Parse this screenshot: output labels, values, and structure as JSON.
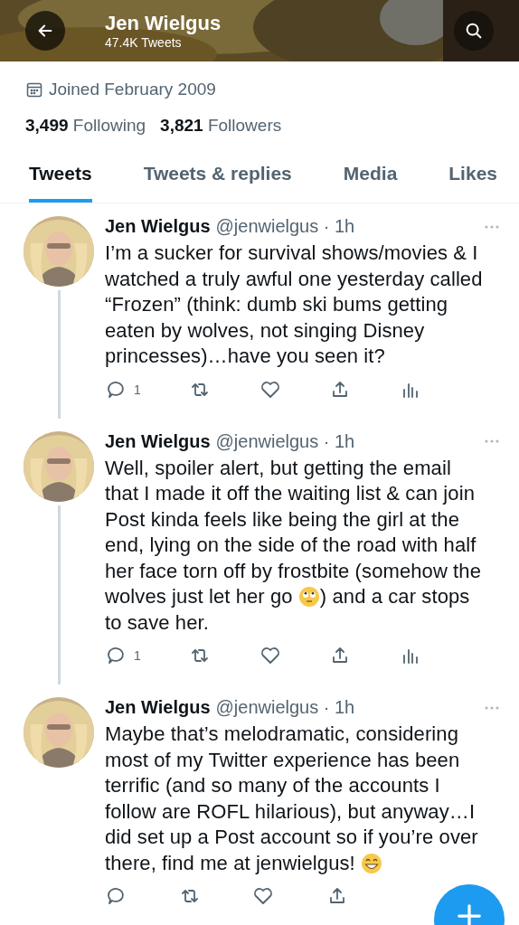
{
  "header": {
    "title": "Jen Wielgus",
    "subtitle": "47.4K Tweets"
  },
  "profile": {
    "joined": "Joined February 2009",
    "following_count": "3,499",
    "following_label": "Following",
    "followers_count": "3,821",
    "followers_label": "Followers"
  },
  "tabs": [
    {
      "label": "Tweets",
      "selected": true
    },
    {
      "label": "Tweets & replies",
      "selected": false
    },
    {
      "label": "Media",
      "selected": false
    },
    {
      "label": "Likes",
      "selected": false
    }
  ],
  "tweets": [
    {
      "name": "Jen Wielgus",
      "handle": "@jenwielgus",
      "time": "· 1h",
      "thread_line": true,
      "reply_count": "1",
      "show_views": true,
      "body": [
        {
          "kind": "text",
          "text": "I’m a sucker for survival shows/movies & I watched a truly awful one yesterday called “Frozen” (think: dumb ski bums getting eaten by wolves, not singing Disney princesses)…have you seen it?"
        }
      ]
    },
    {
      "name": "Jen Wielgus",
      "handle": "@jenwielgus",
      "time": "· 1h",
      "thread_line": true,
      "reply_count": "1",
      "show_views": true,
      "body": [
        {
          "kind": "text",
          "text": "Well, spoiler alert, but getting the email that I made it off the waiting list & can join Post kinda feels like being the girl at the end, lying on the side of the road with half her face torn off by frostbite (somehow the wolves just let her go "
        },
        {
          "kind": "eyeroll"
        },
        {
          "kind": "text",
          "text": ") and a car stops to save her."
        }
      ]
    },
    {
      "name": "Jen Wielgus",
      "handle": "@jenwielgus",
      "time": "· 1h",
      "thread_line": false,
      "show_views": false,
      "body": [
        {
          "kind": "text",
          "text": "Maybe that’s melodramatic, considering most of my Twitter experience has been terrific (and so many of the accounts I follow are ROFL hilarious), but anyway…I did set up a Post account so if you’re over there, find me at jenwielgus! "
        },
        {
          "kind": "grin"
        }
      ]
    }
  ]
}
